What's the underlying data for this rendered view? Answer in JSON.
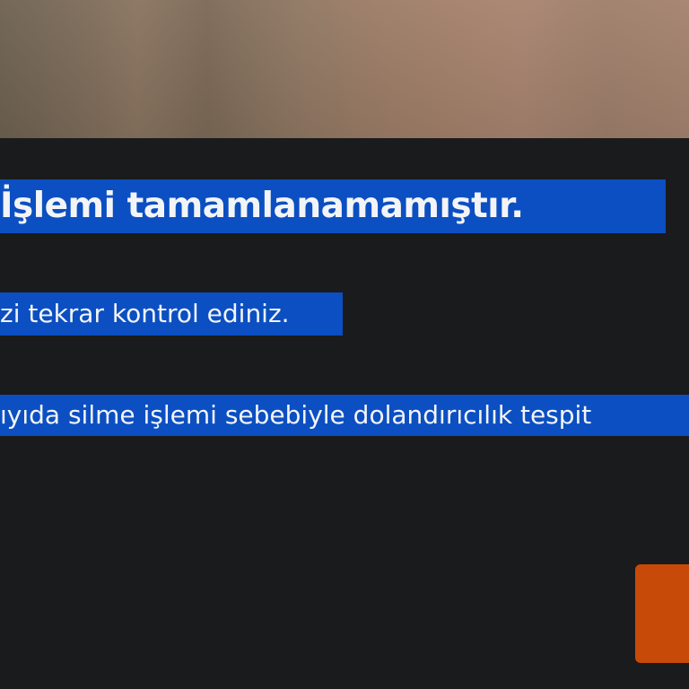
{
  "dialog": {
    "title": "İşlemi tamamlanamamıştır.",
    "message_line_1": "zi tekrar kontrol ediniz.",
    "message_line_2": "ıyıda silme işlemi sebebiyle dolandırıcılık tespit"
  },
  "colors": {
    "background": "#1a1b1d",
    "selection_highlight": "#0b4fc2",
    "action_button": "#c84a08"
  }
}
